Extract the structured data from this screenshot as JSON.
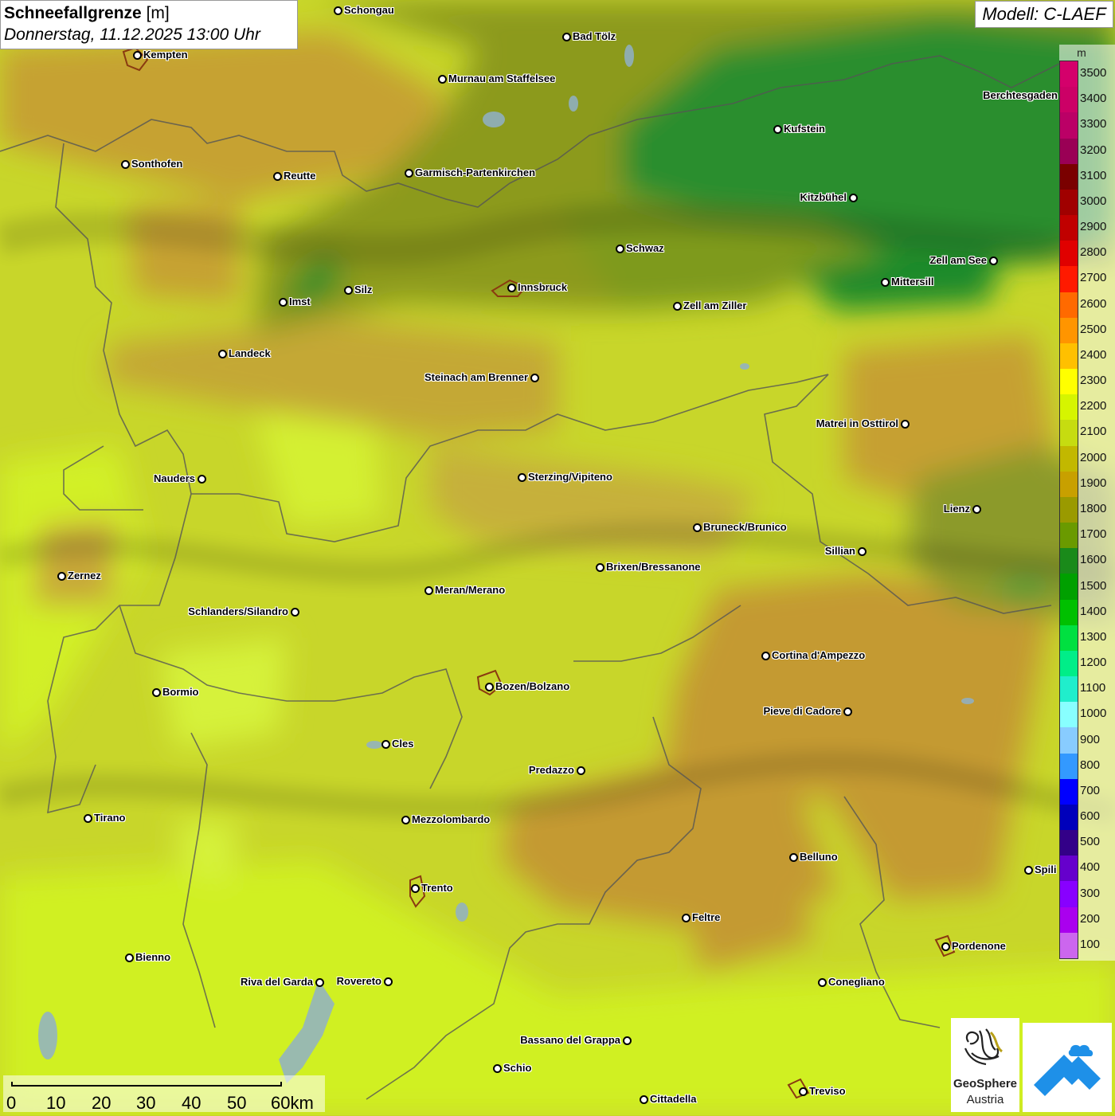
{
  "header": {
    "title_bold": "Schneefallgrenze",
    "title_unit": "[m]",
    "datetime": "Donnerstag, 11.12.2025 13:00 Uhr",
    "model": "Modell: C-LAEF"
  },
  "legend": {
    "unit": "m",
    "steps": [
      {
        "label": "3500",
        "color": "#d4006b"
      },
      {
        "label": "3400",
        "color": "#cc0066"
      },
      {
        "label": "3300",
        "color": "#bb0066"
      },
      {
        "label": "3200",
        "color": "#9a0055"
      },
      {
        "label": "3100",
        "color": "#7a0000"
      },
      {
        "label": "3000",
        "color": "#a00000"
      },
      {
        "label": "2900",
        "color": "#c00000"
      },
      {
        "label": "2800",
        "color": "#e00000"
      },
      {
        "label": "2700",
        "color": "#ff1a00"
      },
      {
        "label": "2600",
        "color": "#ff6a00"
      },
      {
        "label": "2500",
        "color": "#ff9500"
      },
      {
        "label": "2400",
        "color": "#ffc000"
      },
      {
        "label": "2300",
        "color": "#ffff00"
      },
      {
        "label": "2200",
        "color": "#d6f500"
      },
      {
        "label": "2100",
        "color": "#c6dc10"
      },
      {
        "label": "2000",
        "color": "#c2b800"
      },
      {
        "label": "1900",
        "color": "#c8a000"
      },
      {
        "label": "1800",
        "color": "#9a9a00"
      },
      {
        "label": "1700",
        "color": "#6a9a00"
      },
      {
        "label": "1600",
        "color": "#1a8a1a"
      },
      {
        "label": "1500",
        "color": "#00a000"
      },
      {
        "label": "1400",
        "color": "#00c000"
      },
      {
        "label": "1300",
        "color": "#00e040"
      },
      {
        "label": "1200",
        "color": "#00ee88"
      },
      {
        "label": "1100",
        "color": "#20eecc"
      },
      {
        "label": "1000",
        "color": "#88ffff"
      },
      {
        "label": "900",
        "color": "#88ccff"
      },
      {
        "label": "800",
        "color": "#3399ff"
      },
      {
        "label": "700",
        "color": "#0000ff"
      },
      {
        "label": "600",
        "color": "#0000bb"
      },
      {
        "label": "500",
        "color": "#330088"
      },
      {
        "label": "400",
        "color": "#6600cc"
      },
      {
        "label": "300",
        "color": "#8800ff"
      },
      {
        "label": "200",
        "color": "#aa00ee"
      },
      {
        "label": "100",
        "color": "#cc66ee"
      }
    ]
  },
  "cities": [
    {
      "name": "Schongau",
      "label_side": "right"
    },
    {
      "name": "Bad Tölz",
      "label_side": "right"
    },
    {
      "name": "Kempten",
      "label_side": "right"
    },
    {
      "name": "Murnau am Staffelsee",
      "label_side": "right"
    },
    {
      "name": "Berchtesgaden",
      "label_side": "left"
    },
    {
      "name": "Kufstein",
      "label_side": "right"
    },
    {
      "name": "Sonthofen",
      "label_side": "right"
    },
    {
      "name": "Reutte",
      "label_side": "right"
    },
    {
      "name": "Garmisch-Partenkirchen",
      "label_side": "right"
    },
    {
      "name": "Kitzbühel",
      "label_side": "left"
    },
    {
      "name": "Schwaz",
      "label_side": "right"
    },
    {
      "name": "Zell am See",
      "label_side": "left"
    },
    {
      "name": "Mittersill",
      "label_side": "right"
    },
    {
      "name": "Silz",
      "label_side": "right"
    },
    {
      "name": "Innsbruck",
      "label_side": "right"
    },
    {
      "name": "Imst",
      "label_side": "right"
    },
    {
      "name": "Zell am Ziller",
      "label_side": "right"
    },
    {
      "name": "Landeck",
      "label_side": "right"
    },
    {
      "name": "Steinach am Brenner",
      "label_side": "left"
    },
    {
      "name": "Matrei in Osttirol",
      "label_side": "left"
    },
    {
      "name": "Nauders",
      "label_side": "left"
    },
    {
      "name": "Sterzing/Vipiteno",
      "label_side": "right"
    },
    {
      "name": "Lienz",
      "label_side": "left"
    },
    {
      "name": "Bruneck/Brunico",
      "label_side": "right"
    },
    {
      "name": "Sillian",
      "label_side": "left"
    },
    {
      "name": "Brixen/Bressanone",
      "label_side": "right"
    },
    {
      "name": "Zernez",
      "label_side": "right"
    },
    {
      "name": "Meran/Merano",
      "label_side": "right"
    },
    {
      "name": "Schlanders/Silandro",
      "label_side": "left"
    },
    {
      "name": "Cortina d'Ampezzo",
      "label_side": "right"
    },
    {
      "name": "Bozen/Bolzano",
      "label_side": "right"
    },
    {
      "name": "Bormio",
      "label_side": "right"
    },
    {
      "name": "Pieve di Cadore",
      "label_side": "left"
    },
    {
      "name": "Cles",
      "label_side": "right"
    },
    {
      "name": "Predazzo",
      "label_side": "left"
    },
    {
      "name": "Tirano",
      "label_side": "right"
    },
    {
      "name": "Mezzolombardo",
      "label_side": "right"
    },
    {
      "name": "Belluno",
      "label_side": "right"
    },
    {
      "name": "Spili",
      "label_side": "right"
    },
    {
      "name": "Trento",
      "label_side": "right"
    },
    {
      "name": "Feltre",
      "label_side": "right"
    },
    {
      "name": "Pordenone",
      "label_side": "right"
    },
    {
      "name": "Bienno",
      "label_side": "right"
    },
    {
      "name": "Riva del Garda",
      "label_side": "left"
    },
    {
      "name": "Rovereto",
      "label_side": "left"
    },
    {
      "name": "Conegliano",
      "label_side": "right"
    },
    {
      "name": "Bassano del Grappa",
      "label_side": "left"
    },
    {
      "name": "Schio",
      "label_side": "right"
    },
    {
      "name": "Treviso",
      "label_side": "right"
    },
    {
      "name": "Cittadella",
      "label_side": "right"
    }
  ],
  "scale_bar": {
    "labels": [
      "0",
      "10",
      "20",
      "30",
      "40",
      "50",
      "60km"
    ]
  },
  "logo": {
    "line1": "GeoSphere",
    "line2": "Austria"
  }
}
